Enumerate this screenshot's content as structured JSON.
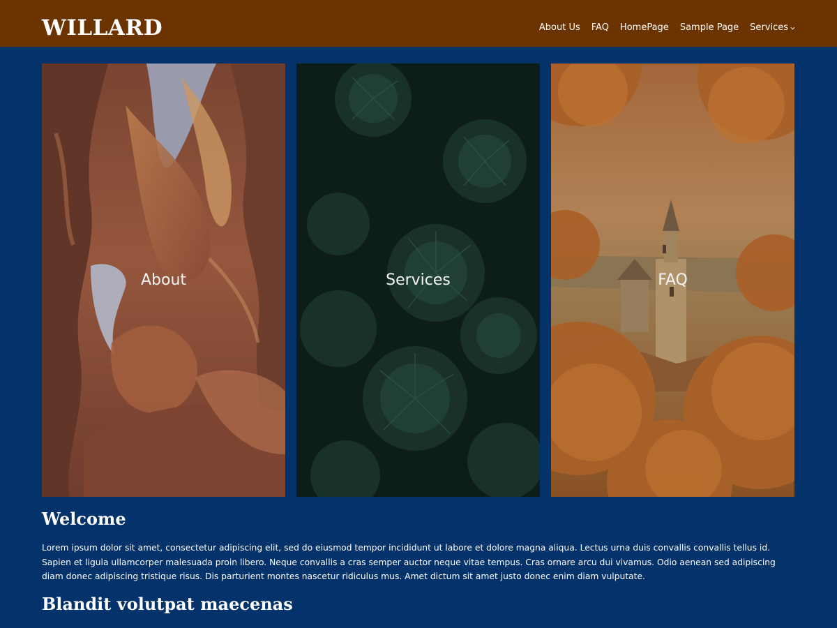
{
  "header": {
    "site_title": "WILLARD",
    "nav": [
      {
        "label": "About Us"
      },
      {
        "label": "FAQ"
      },
      {
        "label": "HomePage"
      },
      {
        "label": "Sample Page"
      },
      {
        "label": "Services",
        "has_submenu": true
      }
    ],
    "submenu_icon": "chevron-down-icon"
  },
  "cards": [
    {
      "label": "About",
      "image": "canyon-photo"
    },
    {
      "label": "Services",
      "image": "leaves-photo"
    },
    {
      "label": "FAQ",
      "image": "autumn-town-photo"
    }
  ],
  "content": {
    "heading": "Welcome",
    "paragraph": "Lorem ipsum dolor sit amet, consectetur adipiscing elit, sed do eiusmod tempor incididunt ut labore et dolore magna aliqua. Lectus urna duis convallis convallis tellus id. Sapien et ligula ullamcorper malesuada proin libero. Neque convallis a cras semper auctor neque vitae tempus. Cras ornare arcu dui vivamus. Odio aenean sed adipiscing diam donec adipiscing tristique risus. Dis parturient montes nascetur ridiculus mus. Amet dictum sit amet justo donec enim diam vulputate.",
    "subheading": "Blandit volutpat maecenas"
  },
  "colors": {
    "header_bg": "#6b3300",
    "page_bg": "#04326a",
    "text": "#ffffff"
  }
}
